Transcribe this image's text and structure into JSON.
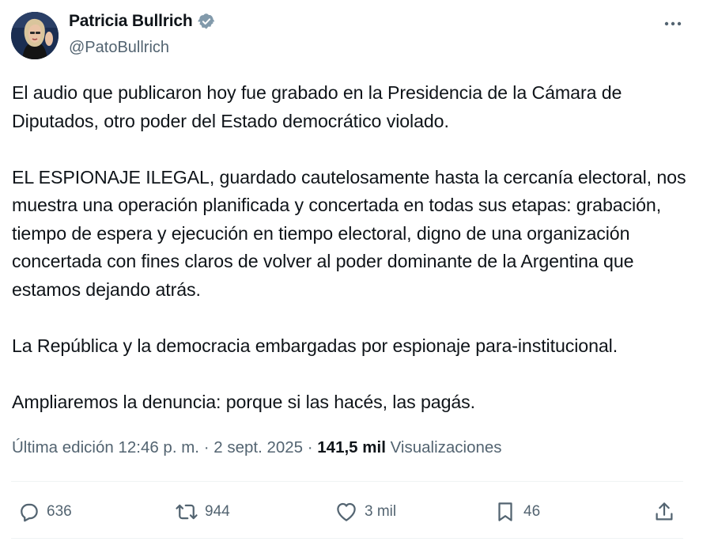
{
  "author": {
    "display_name": "Patricia Bullrich",
    "handle": "@PatoBullrich",
    "verified": true
  },
  "icons": {
    "verified": "verified-badge-icon",
    "more": "more-dots-icon",
    "reply": "reply-icon",
    "repost": "repost-icon",
    "like": "like-icon",
    "bookmark": "bookmark-icon",
    "share": "share-icon"
  },
  "colors": {
    "verified_badge": "#829aab",
    "secondary_text": "#536471",
    "primary_text": "#0f1419",
    "divider": "#eff3f4"
  },
  "body": {
    "paragraphs": [
      "El audio que publicaron hoy fue grabado en la Presidencia de la Cámara de Diputados, otro poder del Estado democrático violado.",
      "EL ESPIONAJE ILEGAL, guardado cautelosamente hasta la cercanía electoral, nos muestra una operación planificada y concertada en todas sus etapas: grabación, tiempo de espera y ejecución en tiempo electoral, digno de una organización concertada con fines claros de volver al poder dominante de la Argentina que estamos dejando atrás.",
      "La República y la democracia embargadas por espionaje para-institucional.",
      "Ampliaremos la denuncia: porque si las hacés, las pagás."
    ]
  },
  "meta": {
    "edited_label": "Última edición 12:46 p. m. · 2 sept. 2025 · ",
    "views_count": "141,5 mil",
    "views_label": "Visualizaciones"
  },
  "actions": {
    "replies": "636",
    "reposts": "944",
    "likes": "3 mil",
    "bookmarks": "46"
  }
}
